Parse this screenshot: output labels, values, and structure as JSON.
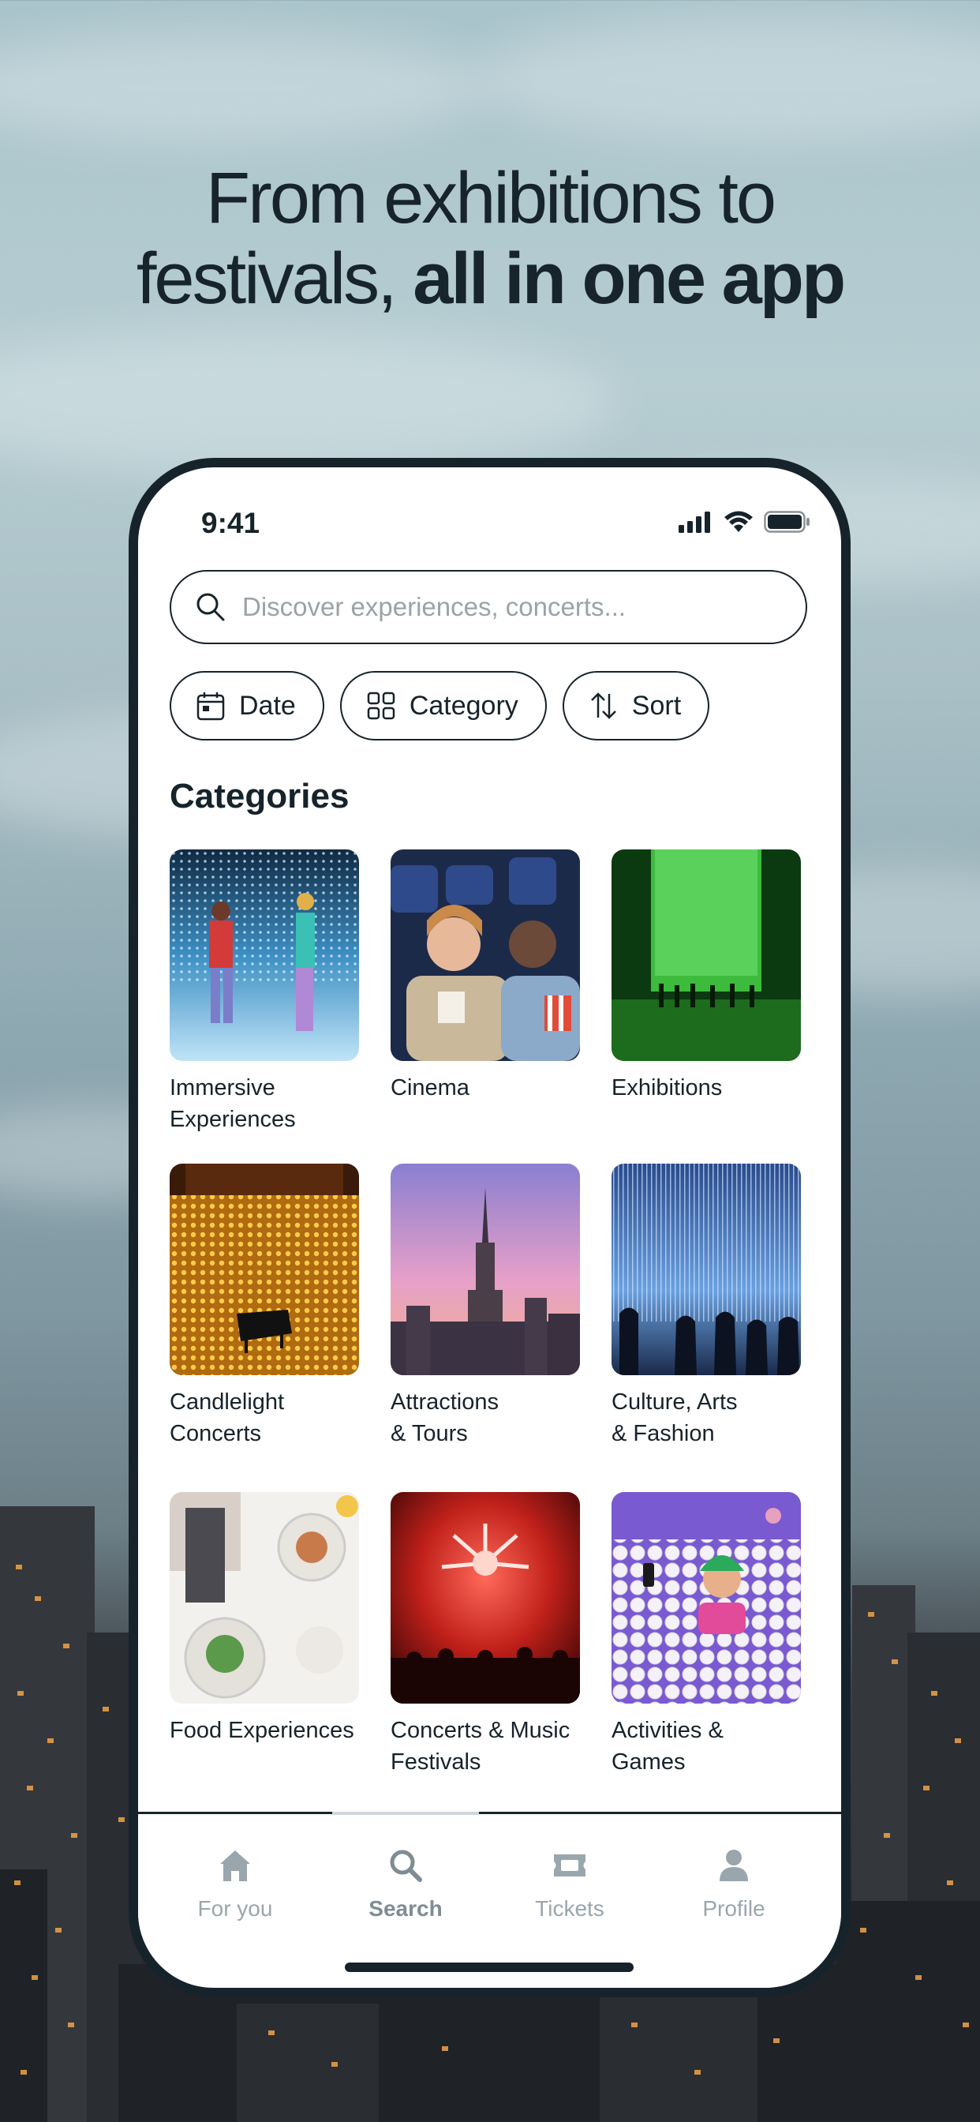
{
  "headline": {
    "line1": "From exhibitions to",
    "line2_regular": "festivals, ",
    "line2_bold": "all in one app"
  },
  "status_bar": {
    "time": "9:41"
  },
  "search": {
    "placeholder": "Discover experiences, concerts..."
  },
  "filters": [
    {
      "label": "Date",
      "icon": "calendar-icon"
    },
    {
      "label": "Category",
      "icon": "grid-icon"
    },
    {
      "label": "Sort",
      "icon": "sort-arrows-icon"
    }
  ],
  "categories_title": "Categories",
  "categories": [
    {
      "label": "Immersive\nExperiences",
      "image": "immersive-mirror-room"
    },
    {
      "label": "Cinema",
      "image": "cinema-audience"
    },
    {
      "label": "Exhibitions",
      "image": "green-light-exhibition"
    },
    {
      "label": "Candlelight\nConcerts",
      "image": "candlelight-piano"
    },
    {
      "label": "Attractions\n& Tours",
      "image": "empire-state-skyline"
    },
    {
      "label": "Culture, Arts\n& Fashion",
      "image": "light-installation-silhouettes"
    },
    {
      "label": "Food Experiences",
      "image": "dinner-table"
    },
    {
      "label": "Concerts & Music\nFestivals",
      "image": "red-stage-concert"
    },
    {
      "label": "Activities & Games",
      "image": "ball-pit"
    }
  ],
  "tabs": [
    {
      "label": "For you",
      "icon": "home-icon",
      "active": false
    },
    {
      "label": "Search",
      "icon": "search-icon",
      "active": true
    },
    {
      "label": "Tickets",
      "icon": "ticket-icon",
      "active": false
    },
    {
      "label": "Profile",
      "icon": "person-icon",
      "active": false
    }
  ],
  "colors": {
    "ink": "#17232a",
    "tab_inactive": "#9aa6ad",
    "placeholder": "#9aa3a8"
  }
}
